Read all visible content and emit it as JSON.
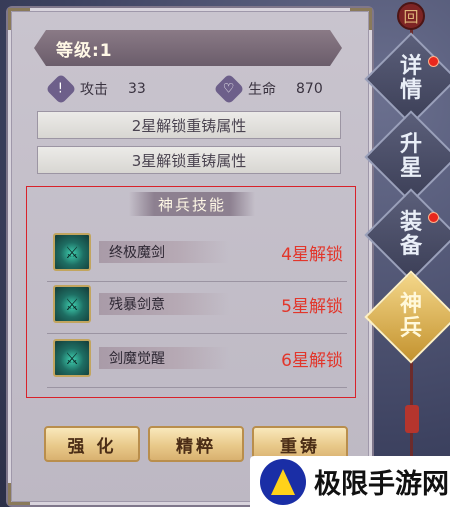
{
  "level": {
    "label": "等级:1"
  },
  "stats": [
    {
      "name": "攻击",
      "value": "33",
      "icon": "sword-icon",
      "glyph": "!"
    },
    {
      "name": "生命",
      "value": "870",
      "icon": "heart-icon",
      "glyph": "♡"
    }
  ],
  "reforge": [
    "2星解锁重铸属性",
    "3星解锁重铸属性"
  ],
  "skills": {
    "title": "神兵技能",
    "items": [
      {
        "name": "终极魔剑",
        "unlock": "4星解锁"
      },
      {
        "name": "残暴剑意",
        "unlock": "5星解锁"
      },
      {
        "name": "剑魔觉醒",
        "unlock": "6星解锁"
      }
    ]
  },
  "buttons": [
    "强 化",
    "精粹",
    "重铸"
  ],
  "tabs": [
    {
      "top": "详",
      "bottom": "情",
      "badge": true,
      "active": false
    },
    {
      "top": "升",
      "bottom": "星",
      "badge": false,
      "active": false
    },
    {
      "top": "装",
      "bottom": "备",
      "badge": true,
      "active": false
    },
    {
      "top": "神",
      "bottom": "兵",
      "badge": false,
      "active": true
    }
  ],
  "knob": {
    "glyph": "回"
  },
  "watermark": {
    "text": "极限手游网"
  },
  "colors": {
    "unlock": "#e2362b",
    "highlight_border": "#d8222a",
    "active_tab": "#e8c46a"
  }
}
